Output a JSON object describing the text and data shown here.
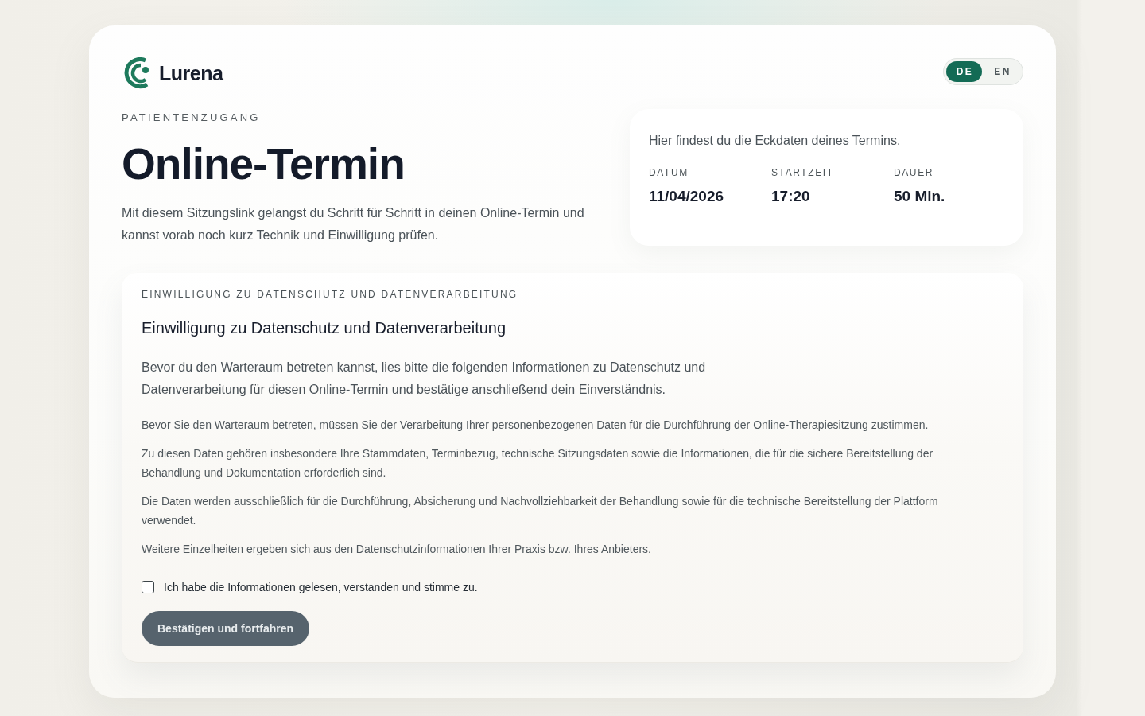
{
  "brand": {
    "name": "Lurena"
  },
  "language_toggle": [
    {
      "label": "DE",
      "selected": true
    },
    {
      "label": "EN",
      "selected": false
    }
  ],
  "hero": {
    "eyebrow": "PATIENTENZUGANG",
    "title": "Online-Termin",
    "description": "Mit diesem Sitzungslink gelangst du Schritt für Schritt in deinen Online-Termin und kannst vorab noch kurz Technik und Einwilligung prüfen."
  },
  "appointment_card": {
    "intro": "Hier findest du die Eckdaten deines Termins.",
    "fields": [
      {
        "label": "DATUM",
        "value": "11/04/2026"
      },
      {
        "label": "STARTZEIT",
        "value": "17:20"
      },
      {
        "label": "DAUER",
        "value": "50 Min."
      }
    ]
  },
  "consent": {
    "eyebrow": "EINWILLIGUNG ZU DATENSCHUTZ UND DATENVERARBEITUNG",
    "title": "Einwilligung zu Datenschutz und Datenverarbeitung",
    "lead": "Bevor du den Warteraum betreten kannst, lies bitte die folgenden Informationen zu Datenschutz und Datenverarbeitung für diesen Online-Termin und bestätige anschließend dein Einverständnis.",
    "paragraphs": [
      "Bevor Sie den Warteraum betreten, müssen Sie der Verarbeitung Ihrer personenbezogenen Daten für die Durchführung der Online-Therapiesitzung zustimmen.",
      "Zu diesen Daten gehören insbesondere Ihre Stammdaten, Terminbezug, technische Sitzungsdaten sowie die Informationen, die für die sichere Bereitstellung der Behandlung und Dokumentation erforderlich sind.",
      "Die Daten werden ausschließlich für die Durchführung, Absicherung und Nachvollziehbarkeit der Behandlung sowie für die technische Bereitstellung der Plattform verwendet.",
      "Weitere Einzelheiten ergeben sich aus den Datenschutzinformationen Ihrer Praxis bzw. Ihres Anbieters."
    ],
    "checkbox": {
      "label": "Ich habe die Informationen gelesen, verstanden und stimme zu.",
      "checked": false
    },
    "button": {
      "label": "Bestätigen und fortfahren",
      "disabled": true
    }
  }
}
